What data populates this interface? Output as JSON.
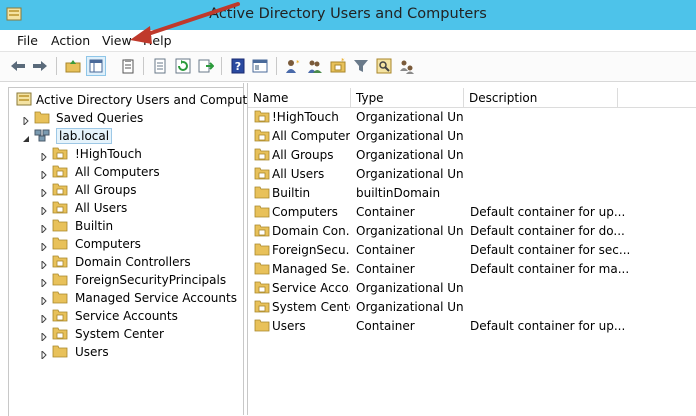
{
  "window": {
    "title": "Active Directory Users and Computers"
  },
  "menu": [
    "File",
    "Action",
    "View",
    "Help"
  ],
  "toolbar": {
    "buttons": [
      "back-icon",
      "forward-icon",
      "up-folder-icon",
      "show-hide-tree-icon",
      "properties-icon",
      "export-list-icon",
      "refresh-icon",
      "export-icon",
      "help-icon",
      "console-view-icon",
      "new-user-icon",
      "new-group-icon",
      "new-ou-icon",
      "filter-icon",
      "find-icon",
      "delegate-icon"
    ]
  },
  "tree": {
    "root": "Active Directory Users and Computers [",
    "items": [
      {
        "label": "Saved Queries",
        "level": 1
      },
      {
        "label": "lab.local",
        "level": 1,
        "selected": true
      },
      {
        "label": "!HighTouch",
        "level": 2
      },
      {
        "label": "All Computers",
        "level": 2
      },
      {
        "label": "All Groups",
        "level": 2
      },
      {
        "label": "All Users",
        "level": 2
      },
      {
        "label": "Builtin",
        "level": 2
      },
      {
        "label": "Computers",
        "level": 2
      },
      {
        "label": "Domain Controllers",
        "level": 2
      },
      {
        "label": "ForeignSecurityPrincipals",
        "level": 2
      },
      {
        "label": "Managed Service Accounts",
        "level": 2
      },
      {
        "label": "Service Accounts",
        "level": 2
      },
      {
        "label": "System Center",
        "level": 2
      },
      {
        "label": "Users",
        "level": 2
      }
    ]
  },
  "list": {
    "columns": [
      "Name",
      "Type",
      "Description"
    ],
    "rows": [
      {
        "name": "!HighTouch",
        "type": "Organizational Unit",
        "description": ""
      },
      {
        "name": "All Computers",
        "type": "Organizational Unit",
        "description": ""
      },
      {
        "name": "All Groups",
        "type": "Organizational Unit",
        "description": ""
      },
      {
        "name": "All Users",
        "type": "Organizational Unit",
        "description": ""
      },
      {
        "name": "Builtin",
        "type": "builtinDomain",
        "description": ""
      },
      {
        "name": "Computers",
        "type": "Container",
        "description": "Default container for up..."
      },
      {
        "name": "Domain Con...",
        "type": "Organizational Unit",
        "description": "Default container for do..."
      },
      {
        "name": "ForeignSecu...",
        "type": "Container",
        "description": "Default container for sec..."
      },
      {
        "name": "Managed Se...",
        "type": "Container",
        "description": "Default container for ma..."
      },
      {
        "name": "Service Acco...",
        "type": "Organizational Unit",
        "description": ""
      },
      {
        "name": "System Center",
        "type": "Organizational Unit",
        "description": ""
      },
      {
        "name": "Users",
        "type": "Container",
        "description": "Default container for up..."
      }
    ]
  },
  "colors": {
    "titlebar": "#4dc3ea",
    "annotation_arrow": "#c0392b",
    "folder": "#e8c15a"
  }
}
